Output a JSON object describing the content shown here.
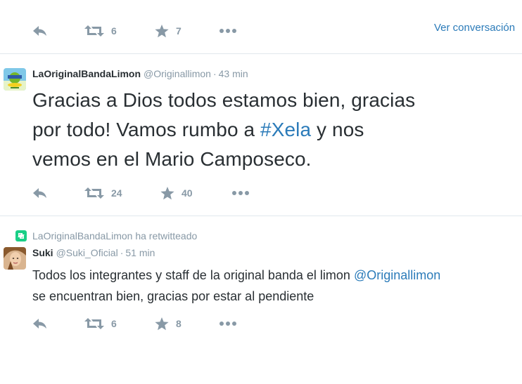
{
  "colors": {
    "action_gray": "#8899a6",
    "link_blue": "#2b7bb9",
    "retweet_green": "#19cf86",
    "divider": "#e1e8ed",
    "text": "#292f33"
  },
  "icons": {
    "reply": "reply-icon",
    "retweet": "retweet-icon",
    "favorite": "star-icon",
    "more": "more-dots-icon"
  },
  "top_tweet": {
    "retweets": "6",
    "favorites": "7",
    "view_conversation": "Ver conversación"
  },
  "tweet1": {
    "fullname": "LaOriginalBandaLimon",
    "username": "@Originallimon",
    "separator": "·",
    "time": "43 min",
    "text_line1": "Gracias a Dios todos estamos bien, gracias",
    "text_line2_pre": "por todo! Vamos rumbo a ",
    "hashtag": "#Xela",
    "text_line2_post": " y nos",
    "text_line3": "vemos en el Mario Camposeco.",
    "retweets": "24",
    "favorites": "40"
  },
  "tweet2": {
    "context": "LaOriginalBandaLimon ha retwitteado",
    "fullname": "Suki",
    "username": "@Suki_Oficial",
    "separator": "·",
    "time": "51 min",
    "text_line1_pre": "Todos los integrantes y staff de la original banda el limon ",
    "mention": "@Originallimon",
    "text_line2": "se encuentran bien, gracias por estar al pendiente",
    "retweets": "6",
    "favorites": "8"
  }
}
